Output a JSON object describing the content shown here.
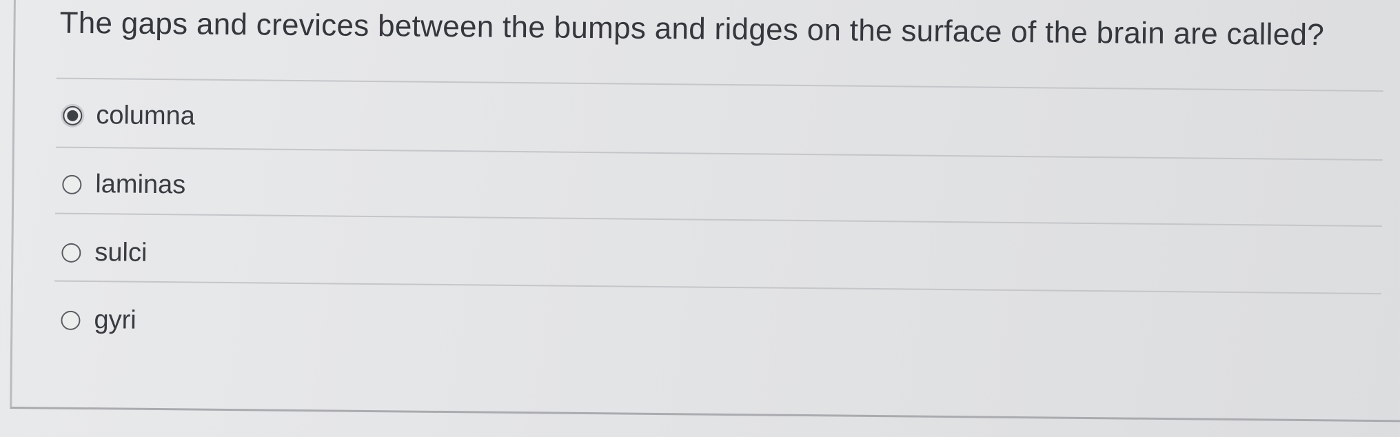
{
  "question": {
    "text": "The gaps and crevices between the bumps and ridges on the surface of the brain are called?"
  },
  "options": [
    {
      "label": "columna",
      "selected": true
    },
    {
      "label": "laminas",
      "selected": false
    },
    {
      "label": "sulci",
      "selected": false
    },
    {
      "label": "gyri",
      "selected": false
    }
  ]
}
